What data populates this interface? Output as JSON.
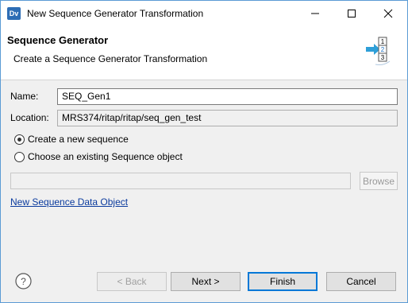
{
  "window": {
    "app_icon_text": "Dv",
    "title": "New Sequence Generator Transformation"
  },
  "banner": {
    "title": "Sequence Generator",
    "description": "Create a Sequence Generator Transformation",
    "graphic_numbers": [
      "1",
      "2",
      "3"
    ]
  },
  "form": {
    "name_label": "Name:",
    "name_value": "SEQ_Gen1",
    "location_label": "Location:",
    "location_value": "MRS374/ritap/ritap/seq_gen_test",
    "radio_create": "Create a new sequence",
    "radio_existing": "Choose an existing Sequence object",
    "sequence_object_value": "",
    "browse_label": "Browse",
    "new_sequence_link": "New Sequence Data Object"
  },
  "buttons": {
    "back": "< Back",
    "next": "Next >",
    "finish": "Finish",
    "cancel": "Cancel"
  },
  "colors": {
    "window_border": "#5b9bd5",
    "link": "#0b3b9e",
    "default_button_border": "#0078d7"
  }
}
